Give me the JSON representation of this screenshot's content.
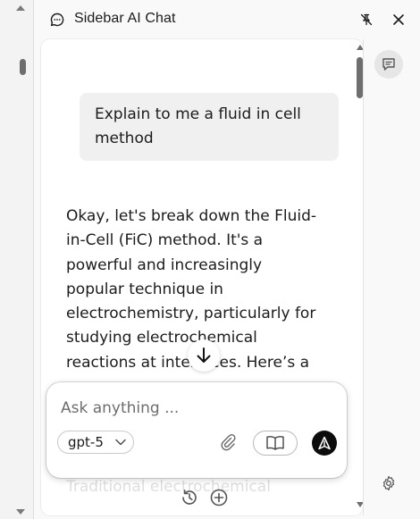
{
  "window": {
    "title": "Sidebar AI Chat"
  },
  "icons": {
    "header": "chat-bubble-icon",
    "pin": "unpin-icon",
    "close": "close-icon",
    "scroll_down": "arrow-down-icon",
    "attach": "paperclip-icon",
    "library": "book-icon",
    "send": "send-icon",
    "history": "history-icon",
    "new_chat": "plus-circle-icon",
    "rail_chat": "chat-icon",
    "rail_settings": "gear-icon"
  },
  "conversation": {
    "user_message": "Explain to me a fluid in cell method",
    "assistant_message": "Okay, let's break down the Fluid-in-Cell (FiC) method. It's a powerful and increasingly popular technique in electrochemistry, particularly for studying electrochemical reactions at interfaces. Here’s a",
    "assistant_faded_line": "Traditional electrochemical"
  },
  "composer": {
    "placeholder": "Ask anything ...",
    "value": "",
    "model": "gpt-5"
  },
  "colors": {
    "background": "#f3f3f3",
    "panel": "#f9f9f9",
    "card": "#ffffff",
    "user_bubble": "#f0f0f0",
    "send_button": "#0c0c0c",
    "text": "#1b1b1b"
  }
}
